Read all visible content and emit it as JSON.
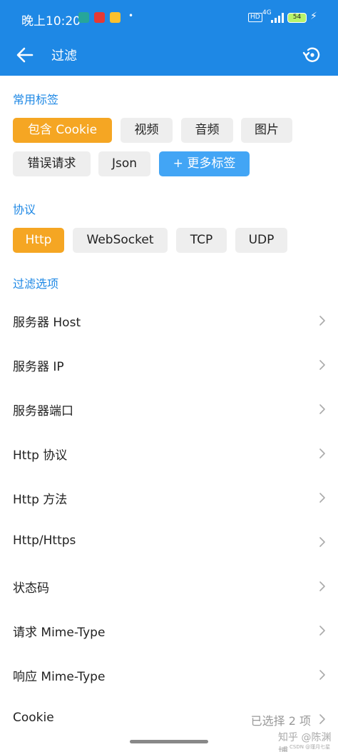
{
  "status_bar": {
    "time": "晚上10:20",
    "dot": "•",
    "hd": "HD",
    "network": "4G",
    "battery": "54",
    "app_colors": [
      "#26a69a",
      "#e53935",
      "#fbc02d"
    ]
  },
  "app_bar": {
    "title": "过滤",
    "back_icon": "arrow-back-icon",
    "reset_icon": "restore-icon"
  },
  "common_tags": {
    "title": "常用标签",
    "chips": [
      {
        "label": "包含 Cookie",
        "active": true
      },
      {
        "label": "视频",
        "active": false
      },
      {
        "label": "音频",
        "active": false
      },
      {
        "label": "图片",
        "active": false
      },
      {
        "label": "错误请求",
        "active": false
      },
      {
        "label": "Json",
        "active": false
      }
    ],
    "more": {
      "icon": "+",
      "label": "更多标签"
    }
  },
  "protocol": {
    "title": "协议",
    "chips": [
      {
        "label": "Http",
        "active": true
      },
      {
        "label": "WebSocket",
        "active": false
      },
      {
        "label": "TCP",
        "active": false
      },
      {
        "label": "UDP",
        "active": false
      }
    ]
  },
  "filter_options": {
    "title": "过滤选项",
    "rows": [
      {
        "label": "服务器 Host",
        "value": ""
      },
      {
        "label": "服务器 IP",
        "value": ""
      },
      {
        "label": "服务器端口",
        "value": ""
      },
      {
        "label": "Http 协议",
        "value": ""
      },
      {
        "label": "Http 方法",
        "value": ""
      },
      {
        "label": "Http/Https",
        "value": ""
      },
      {
        "label": "状态码",
        "value": ""
      },
      {
        "label": "请求 Mime-Type",
        "value": ""
      },
      {
        "label": "响应 Mime-Type",
        "value": ""
      },
      {
        "label": "Cookie",
        "value": "已选择 2 项"
      }
    ]
  },
  "watermark": {
    "text": "知乎 @陈渊博",
    "sub": "CSDN @瑾月七星"
  },
  "colors": {
    "primary": "#1e88e5",
    "accent": "#f5a623",
    "chip": "#eeeeee",
    "more": "#42a5f5"
  }
}
